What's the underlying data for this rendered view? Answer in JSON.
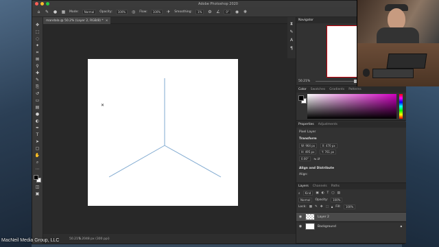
{
  "app": {
    "title": "Adobe Photoshop 2020"
  },
  "options_bar": {
    "mode_label": "Mode:",
    "mode_value": "Normal",
    "opacity_label": "Opacity:",
    "opacity_value": "100%",
    "flow_label": "Flow:",
    "flow_value": "100%",
    "smoothing_label": "Smoothing:",
    "smoothing_value": "1%",
    "angle_value": "0°"
  },
  "document": {
    "tab_label": "mandala @ 50.2% (Layer 2, RGB/8) *"
  },
  "status_bar": {
    "zoom": "50.21%",
    "info": "1.2048 px (300 ppi)"
  },
  "navigator": {
    "tab": "Navigator",
    "zoom": "50.21%"
  },
  "color_panel": {
    "tabs": [
      "Color",
      "Swatches",
      "Gradients",
      "Patterns"
    ]
  },
  "properties": {
    "tabs": [
      "Properties",
      "Adjustments"
    ],
    "layer_type": "Pixel Layer",
    "transform_label": "Transform",
    "w": "W: 964 px",
    "x": "X: 470 px",
    "h": "H: 495 px",
    "y": "Y: 761 px",
    "angle": "0.00°",
    "align_label": "Align and Distribute",
    "align_sub": "Align:"
  },
  "layers": {
    "tabs": [
      "Layers",
      "Channels",
      "Paths"
    ],
    "kind_label": "Kind",
    "blend_mode": "Normal",
    "opacity_label": "Opacity:",
    "opacity_value": "100%",
    "lock_label": "Lock:",
    "fill_label": "Fill:",
    "fill_value": "100%",
    "items": [
      {
        "name": "Layer 2",
        "selected": true
      },
      {
        "name": "Background",
        "selected": false
      }
    ]
  },
  "credit": "MacNeil Media Group, LLC",
  "colors": {
    "accent": "#7fa9d0",
    "navigator_border": "#c8000a"
  }
}
